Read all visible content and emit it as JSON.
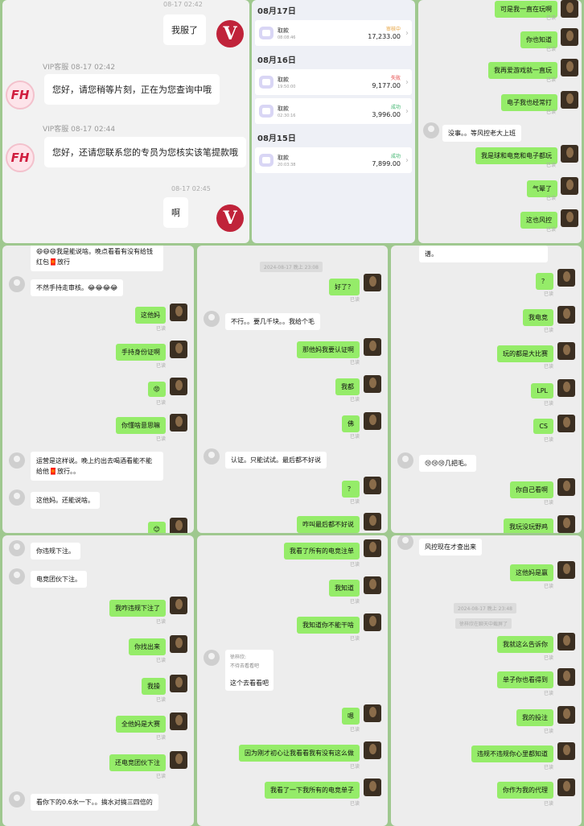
{
  "p1": {
    "ts1": "08-17 02:42",
    "m1": "我服了",
    "agent": "VIP客服",
    "ag_ts1": "08-17 02:42",
    "m2": "您好，请您稍等片刻，正在为您查询中哦",
    "ag_ts2": "08-17 02:44",
    "m3": "您好，还请您联系您的专员为您核实该笔提款哦",
    "ts2": "08-17 02:45",
    "m4": "啊",
    "vip_logo": "V",
    "fh_logo": "FH"
  },
  "p2": {
    "d1": "08月17日",
    "d2": "08月16日",
    "d3": "08月15日",
    "tx": [
      {
        "t": "取款",
        "s": "08:08:46",
        "st": "审核中",
        "a": "17,233.00",
        "c": "#e6a23c"
      },
      {
        "t": "取款",
        "s": "19:50:00",
        "st": "失败",
        "a": "9,177.00",
        "c": "#e64545"
      },
      {
        "t": "取款",
        "s": "02:30:16",
        "st": "成功",
        "a": "3,996.00",
        "c": "#3bb36b"
      },
      {
        "t": "取款",
        "s": "20:03:38",
        "st": "成功",
        "a": "7,899.00",
        "c": "#3bb36b"
      }
    ]
  },
  "p3": {
    "read": "已读",
    "m": [
      "可是我一直在玩啊",
      "你也知道",
      "我再爱游戏就一直玩",
      "电子我也经常打",
      "没事。。等风控老大上班",
      "我是球和电竞和电子都玩",
      "气晕了",
      "这也风控"
    ]
  },
  "p4": {
    "read": "已读",
    "m": [
      "😄😄😄我是能说啥。晚点看看有没有给钱红包🧧放行",
      "不然手持走审核。😂😂😂😂",
      "这他妈",
      "手持身份证啊",
      "😡",
      "你懂啥意思嘛",
      "运营是这样说。晚上约出去喝酒看能不能给他🧧放行。。",
      "这他妈。还能说啥。",
      "😊"
    ]
  },
  "p5": {
    "read": "已读",
    "ts": "2024-08-17 晚上 23:08",
    "m": [
      "好了？",
      "不行。。要几千块。。我给个毛",
      "那他妈我要认证啊",
      "我都",
      "佛",
      "认证。只能试试。最后都不好说",
      "？",
      "咋叫最后都不好说"
    ]
  },
  "p6": {
    "read": "已读",
    "m": [
      "谱。",
      "？",
      "我电竞",
      "玩的都是大比赛",
      "LPL",
      "CS",
      "😢😢😢几把毛。",
      "你自己看啊",
      "我玩没玩野鸡"
    ]
  },
  "p7": {
    "read": "已读",
    "m": [
      "你违规下注。",
      "电竞团伙下注。",
      "我咋违规下注了",
      "你找出来",
      "我操",
      "全他妈是大赛",
      "还电竞团伙下注",
      "看你下的0.6水一下。。搞水对搞三四倍的"
    ]
  },
  "p8": {
    "read": "已读",
    "m": [
      "我看了所有的电竞注单",
      "我知道",
      "我知道你不能干啥",
      "这个去看看吧",
      "嗯",
      "因为刚才初心让我看看我有没有这么做",
      "我看了一下我所有的电竞单子"
    ],
    "quote": "徐梓欣:",
    "quote2": "不待去看看吧"
  },
  "p9": {
    "read": "已读",
    "ts": "2024-08-17 晚上 23:48",
    "sys": "徐梓欣在聊天中截屏了",
    "m": [
      "风控现在才查出来",
      "这他妈是赢",
      "我就这么告诉你",
      "单子你也看得到",
      "我的投注",
      "违规不违规你心里都知道",
      "你作为我的代理"
    ]
  }
}
